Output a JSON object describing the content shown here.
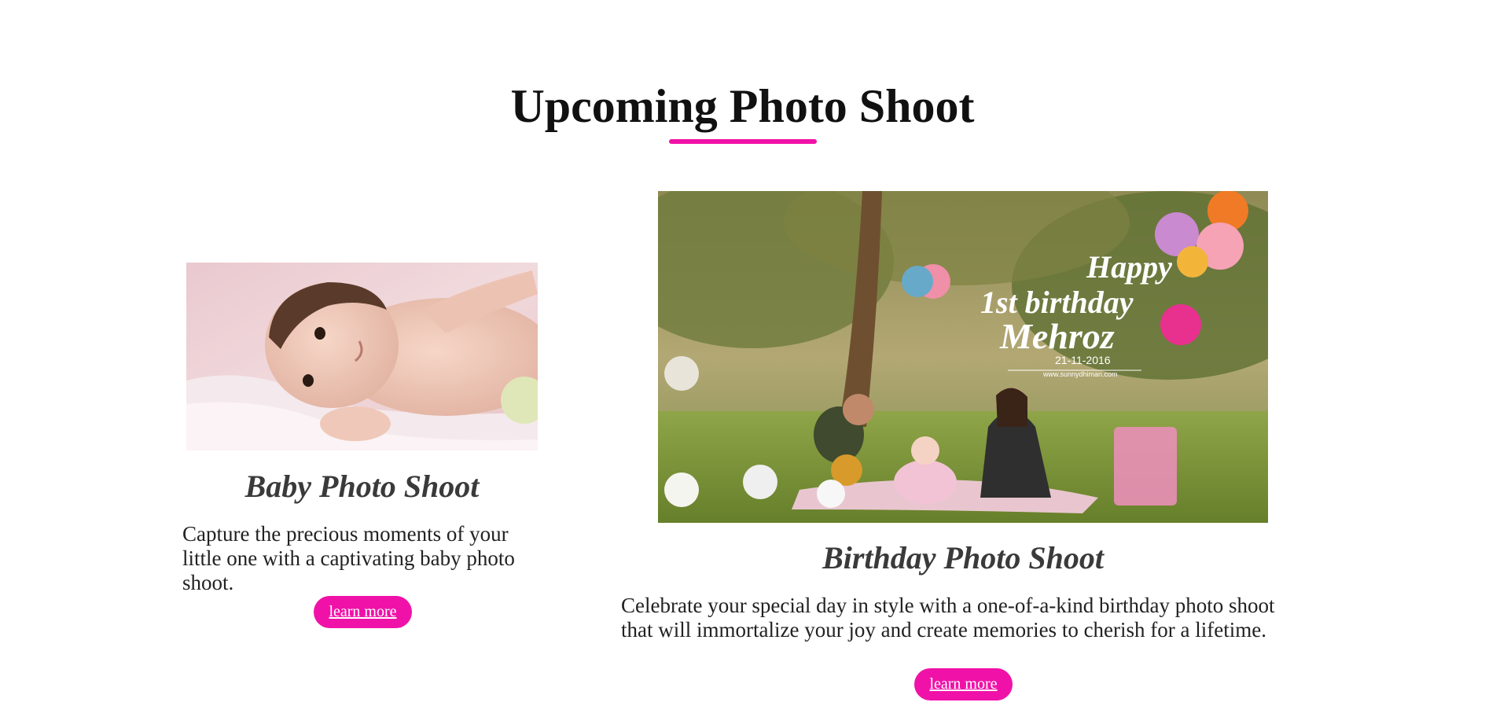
{
  "section": {
    "title": "Upcoming Photo Shoot"
  },
  "colors": {
    "accent": "#f012a8",
    "heading": "#111111",
    "card_title": "#3a3a3a",
    "text": "#222222",
    "background": "#ffffff"
  },
  "cards": [
    {
      "image_alt": "Baby lying on a blanket smiling",
      "title": "Baby Photo Shoot",
      "description": "Capture the precious moments of your little one with a captivating baby photo shoot.",
      "button_label": "learn more"
    },
    {
      "image_alt": "Family picnic with balloons celebrating a first birthday",
      "image_text": {
        "line1": "Happy",
        "line2": "1st birthday",
        "line3": "Mehroz",
        "date": "21-11-2016",
        "site": "www.sunnydhiman.com"
      },
      "title": "Birthday Photo Shoot",
      "description": "Celebrate your special day in style with a one-of-a-kind birthday photo shoot that will immortalize your joy and create memories to cherish for a lifetime.",
      "button_label": "learn more"
    }
  ]
}
